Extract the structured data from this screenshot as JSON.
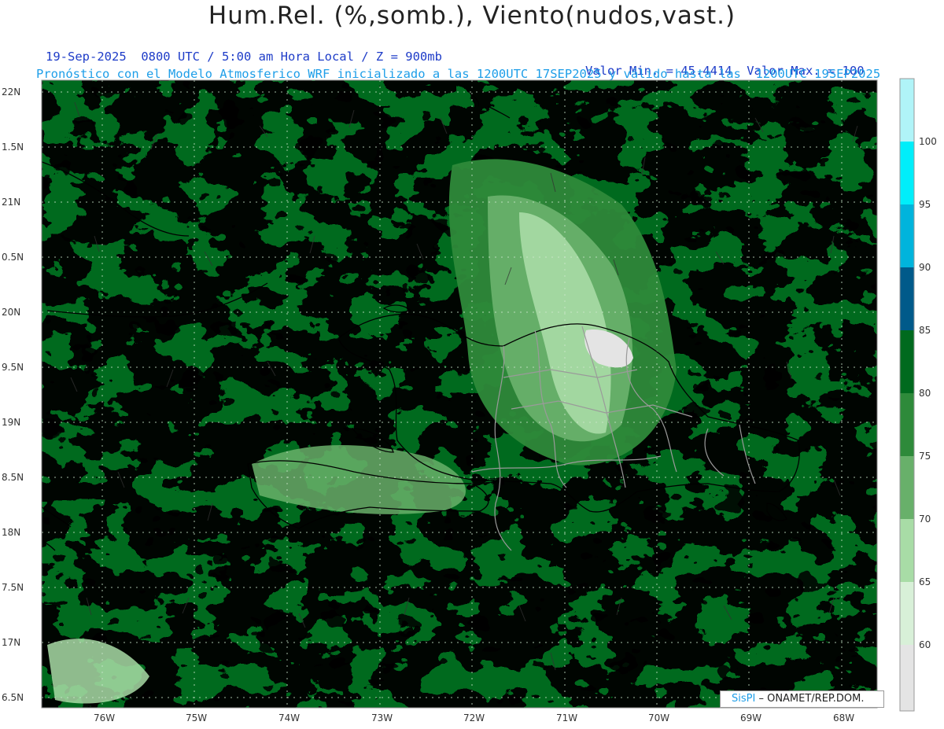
{
  "header": {
    "title": "Hum.Rel. (%,somb.), Viento(nudos,vast.)",
    "line1_left": "19-Sep-2025  0800 UTC / 5:00 am Hora Local / Z = 900mb",
    "line1_right": "Valor Min. = 45.4414  Valor Max. = 100",
    "line2": "Pronóstico con el Modelo Atmosferico WRF inicializado a las 1200UTC_17SEP2025 y válido hasta las  1200UTC_19SEP2025"
  },
  "map": {
    "lat_labels": [
      "22N",
      "1.5N",
      "21N",
      "0.5N",
      "20N",
      "9.5N",
      "19N",
      "8.5N",
      "18N",
      "7.5N",
      "17N",
      "6.5N"
    ],
    "lon_labels": [
      "76W",
      "75W",
      "74W",
      "73W",
      "72W",
      "71W",
      "70W",
      "69W",
      "68W"
    ]
  },
  "colorbar": {
    "labels": [
      "100",
      "95",
      "90",
      "85",
      "80",
      "75",
      "70",
      "65",
      "60"
    ],
    "colors": [
      "#b0f4f8",
      "#00eefa",
      "#00b4dc",
      "#005a8a",
      "#006a1e",
      "#2e8a3a",
      "#68b06a",
      "#a8dca6",
      "#d8f0d8",
      "#e4e4e4"
    ]
  },
  "credit": {
    "logo": "SisPI",
    "text": "– ONAMET/REP.DOM."
  }
}
